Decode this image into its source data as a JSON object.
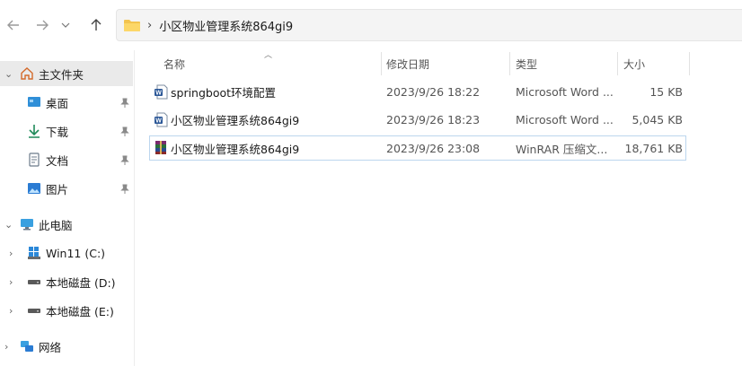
{
  "address": {
    "separator": "›",
    "crumb": "小区物业管理系统864gi9"
  },
  "sidebar": {
    "home": {
      "label": "主文件夹"
    },
    "quick": [
      {
        "label": "桌面",
        "icon": "desktop-icon"
      },
      {
        "label": "下载",
        "icon": "download-icon"
      },
      {
        "label": "文档",
        "icon": "document-icon"
      },
      {
        "label": "图片",
        "icon": "pictures-icon"
      }
    ],
    "this_pc": {
      "label": "此电脑"
    },
    "drives": [
      {
        "label": "Win11 (C:)"
      },
      {
        "label": "本地磁盘 (D:)"
      },
      {
        "label": "本地磁盘 (E:)"
      }
    ],
    "network": {
      "label": "网络"
    }
  },
  "columns": {
    "name": "名称",
    "date": "修改日期",
    "type": "类型",
    "size": "大小"
  },
  "files": [
    {
      "name": "springboot环境配置",
      "date": "2023/9/26 18:22",
      "type": "Microsoft Word ...",
      "size": "15 KB",
      "icon": "word-doc-icon"
    },
    {
      "name": "小区物业管理系统864gi9",
      "date": "2023/9/26 18:23",
      "type": "Microsoft Word ...",
      "size": "5,045 KB",
      "icon": "word-doc-icon"
    },
    {
      "name": "小区物业管理系统864gi9",
      "date": "2023/9/26 23:08",
      "type": "WinRAR 压缩文...",
      "size": "18,761 KB",
      "icon": "winrar-archive-icon"
    }
  ]
}
